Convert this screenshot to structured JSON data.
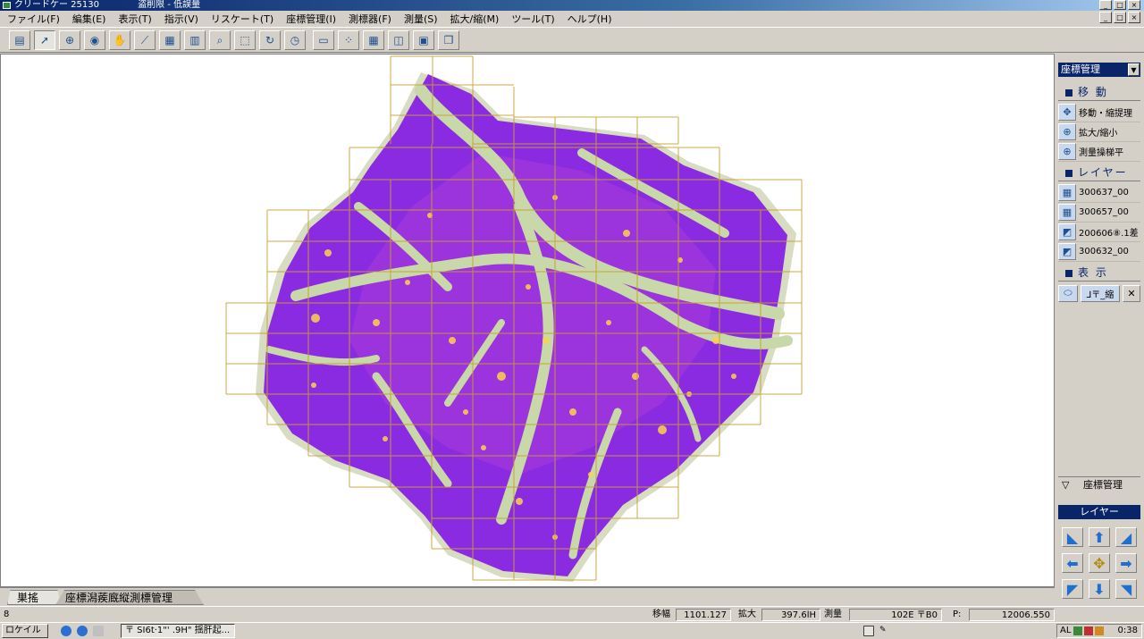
{
  "window": {
    "title": "クリードケー 25130",
    "title2": "盗削限 - 低誤量",
    "min": "_",
    "max": "□",
    "close": "×"
  },
  "menu": [
    "ファイル(F)",
    "編集(E)",
    "表示(T)",
    "指示(V)",
    "リスケート(T)",
    "座標管理(I)",
    "測標器(F)",
    "測量(S)",
    "拡大/縮(M)",
    "ツール(T)",
    "ヘルプ(H)"
  ],
  "toolbar": {
    "icons": [
      "layer-icon",
      "pointer-icon",
      "zoom-in-icon",
      "globe-icon",
      "pan-icon",
      "measure-line-icon",
      "grid-icon",
      "table-icon",
      "search-icon",
      "select-area-icon",
      "rotate-icon",
      "clock-icon",
      "ruler-icon",
      "points-icon",
      "grid-edit-icon",
      "split-icon",
      "export-icon",
      "copy-icon"
    ]
  },
  "panel": {
    "dropdown": "座標管理",
    "move_header": "移 動",
    "move_items": [
      {
        "label": "移動・縮提理",
        "icon": "move-icon"
      },
      {
        "label": "拡大/縮小",
        "icon": "zoom-icon"
      },
      {
        "label": "測量操梯平",
        "icon": "zoom-measure-icon"
      }
    ],
    "layer_header": "レイヤー",
    "layer_items": [
      {
        "label": "300637_00",
        "icon": "grid-layer-icon"
      },
      {
        "label": "300657_00",
        "icon": "grid-layer-icon"
      },
      {
        "label": "200606⑧.1差",
        "icon": "image-layer-icon"
      },
      {
        "label": "300632_00",
        "icon": "image-layer-icon"
      }
    ],
    "view_header": "表 示",
    "view_items": [
      "⬭",
      "⅃〒_縮",
      "✕"
    ],
    "footer": "座標管理",
    "footer_icon": "▽",
    "nav_header": "レイヤー",
    "nav_buttons": [
      "◣",
      "⬆",
      "◢",
      "⬅",
      "✥",
      "➡",
      "◤",
      "⬇",
      "◥"
    ]
  },
  "tabs": [
    "巣搖",
    "座標潟蒺廐縦測標管理"
  ],
  "status": {
    "left": "8",
    "move_label": "移幅",
    "move_value": "1101.127",
    "zoom_label": "拡大",
    "zoom_value": "397.6lH",
    "survey_label": "測量",
    "survey_value": "102E 〒B0",
    "p_label": "P:",
    "p_value": "12006.550"
  },
  "taskbar": {
    "start": "ロケイル",
    "task": "〒 SI6t·1\"' .9H\" 揺肝起...",
    "time": "0:38",
    "tray_text": "AL"
  },
  "colors": {
    "title": "#0a246a",
    "map_fill": "#8a2be2",
    "grid_line": "#c8a030",
    "water": "#c8d8a8",
    "highlight": "#ffd24a"
  }
}
